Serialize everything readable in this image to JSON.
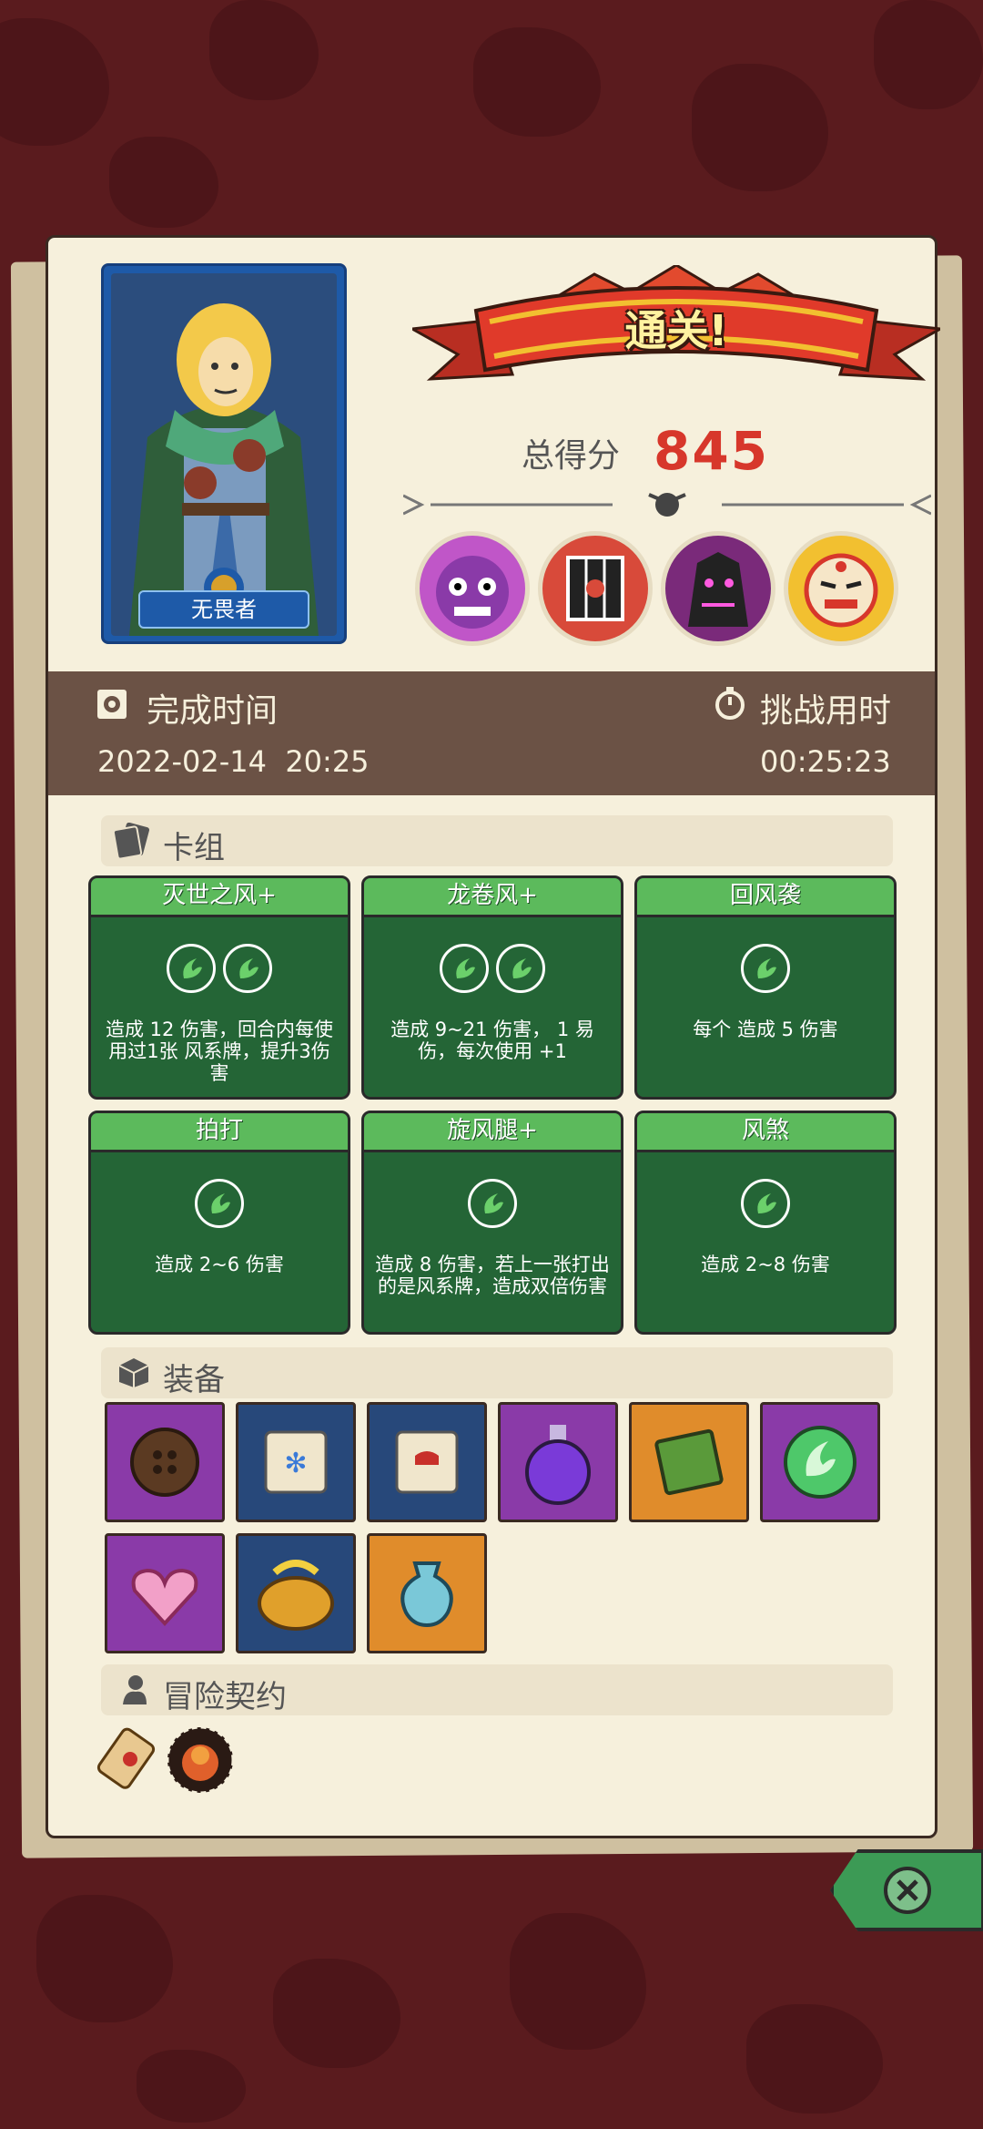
{
  "result": {
    "banner": "通关!",
    "score_label": "总得分",
    "score_value": "845"
  },
  "hero": {
    "name": "无畏者"
  },
  "time": {
    "complete_label": "完成时间",
    "complete_value": "2022-02-14  20:25",
    "challenge_label": "挑战用时",
    "challenge_value": "00:25:23"
  },
  "deck": {
    "title": "卡组",
    "cards": [
      {
        "name": "灭世之风+",
        "gems": 2,
        "desc": "造成 12 伤害，回合内每使用过1张 风系牌，提升3伤害"
      },
      {
        "name": "龙卷风+",
        "gems": 2,
        "desc": "造成 9~21 伤害， 1 易伤，每次使用 +1"
      },
      {
        "name": "回风袭",
        "gems": 1,
        "desc": "每个 造成 5 伤害"
      },
      {
        "name": "拍打",
        "gems": 1,
        "desc": "造成 2~6 伤害"
      },
      {
        "name": "旋风腿+",
        "gems": 1,
        "desc": "造成 8 伤害，若上一张打出的是风系牌，造成双倍伤害"
      },
      {
        "name": "风煞",
        "gems": 1,
        "desc": "造成 2~8 伤害"
      }
    ]
  },
  "equipment": {
    "title": "装备",
    "items": [
      "button-icon",
      "ice-scroll-icon",
      "blood-scroll-icon",
      "purple-potion-icon",
      "moss-book-icon",
      "wind-gem-icon",
      "heart-charm-icon",
      "golden-pot-icon",
      "blue-vase-icon"
    ]
  },
  "contract": {
    "title": "冒险契约",
    "items": [
      "scroll-contract-icon",
      "food-plate-icon"
    ]
  },
  "colors": {
    "accent_red": "#d7372b",
    "card_green": "#246536",
    "panel": "#f6f0dc"
  }
}
